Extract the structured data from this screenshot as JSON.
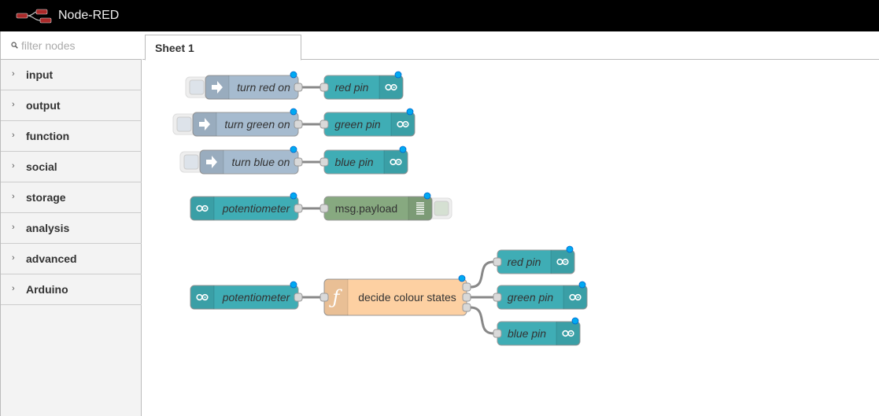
{
  "header": {
    "title": "Node-RED"
  },
  "palette": {
    "filter_placeholder": "filter nodes",
    "categories": [
      {
        "label": "input"
      },
      {
        "label": "output"
      },
      {
        "label": "function"
      },
      {
        "label": "social"
      },
      {
        "label": "storage"
      },
      {
        "label": "analysis"
      },
      {
        "label": "advanced"
      },
      {
        "label": "Arduino"
      }
    ]
  },
  "tabs": [
    {
      "label": "Sheet 1"
    }
  ],
  "colors": {
    "inject": "#a6bbcf",
    "arduino": "#3fadb5",
    "debug": "#87a980",
    "function": "#fdd0a2",
    "changed_dot": "#00a9f2",
    "wire": "#888888"
  },
  "flow": {
    "nodes": [
      {
        "id": "inj1",
        "type": "inject",
        "label": "turn red on",
        "italic": true,
        "icon": "arrow-in-icon"
      },
      {
        "id": "out1",
        "type": "arduino-out",
        "label": "red pin",
        "italic": true,
        "icon": "arduino-icon"
      },
      {
        "id": "inj2",
        "type": "inject",
        "label": "turn green on",
        "italic": true,
        "icon": "arrow-in-icon"
      },
      {
        "id": "out2",
        "type": "arduino-out",
        "label": "green pin",
        "italic": true,
        "icon": "arduino-icon"
      },
      {
        "id": "inj3",
        "type": "inject",
        "label": "turn blue on",
        "italic": true,
        "icon": "arrow-in-icon"
      },
      {
        "id": "out3",
        "type": "arduino-out",
        "label": "blue pin",
        "italic": true,
        "icon": "arduino-icon"
      },
      {
        "id": "pot1",
        "type": "arduino-in",
        "label": "potentiometer",
        "italic": true,
        "icon": "arduino-icon"
      },
      {
        "id": "dbg1",
        "type": "debug",
        "label": "msg.payload",
        "italic": false,
        "icon": "debug-list-icon"
      },
      {
        "id": "pot2",
        "type": "arduino-in",
        "label": "potentiometer",
        "italic": true,
        "icon": "arduino-icon"
      },
      {
        "id": "fn1",
        "type": "function",
        "label": "decide colour states",
        "italic": false,
        "icon": "function-icon"
      },
      {
        "id": "out4",
        "type": "arduino-out",
        "label": "red pin",
        "italic": true,
        "icon": "arduino-icon"
      },
      {
        "id": "out5",
        "type": "arduino-out",
        "label": "green pin",
        "italic": true,
        "icon": "arduino-icon"
      },
      {
        "id": "out6",
        "type": "arduino-out",
        "label": "blue pin",
        "italic": true,
        "icon": "arduino-icon"
      }
    ],
    "wires": [
      [
        "inj1",
        "out1"
      ],
      [
        "inj2",
        "out2"
      ],
      [
        "inj3",
        "out3"
      ],
      [
        "pot1",
        "dbg1"
      ],
      [
        "pot2",
        "fn1"
      ],
      [
        "fn1",
        "out4"
      ],
      [
        "fn1",
        "out5"
      ],
      [
        "fn1",
        "out6"
      ]
    ]
  }
}
